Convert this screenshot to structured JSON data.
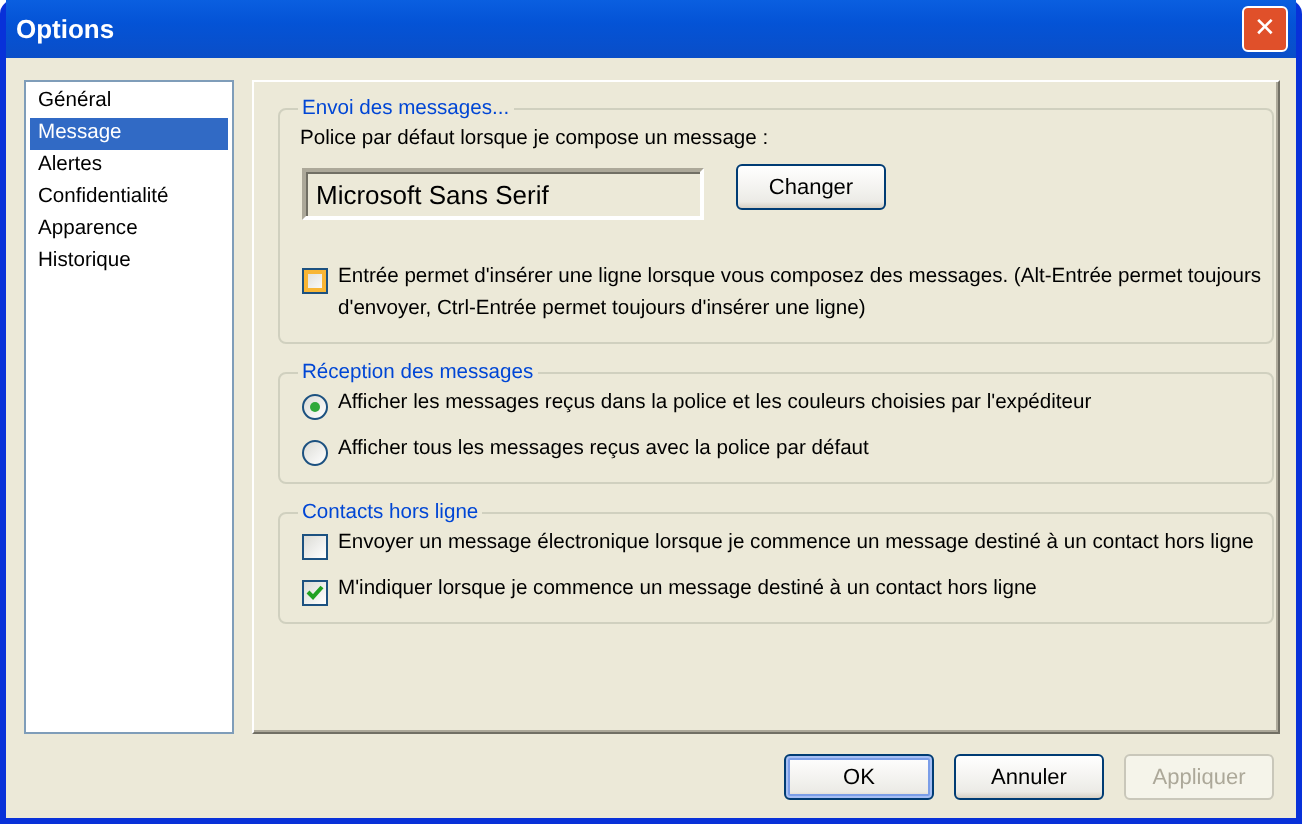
{
  "window": {
    "title": "Options",
    "close_glyph": "✕"
  },
  "sidebar": {
    "items": [
      {
        "label": "Général",
        "selected": false
      },
      {
        "label": "Message",
        "selected": true
      },
      {
        "label": "Alertes",
        "selected": false
      },
      {
        "label": "Confidentialité",
        "selected": false
      },
      {
        "label": "Apparence",
        "selected": false
      },
      {
        "label": "Historique",
        "selected": false
      }
    ]
  },
  "groups": [
    {
      "title": "Envoi des messages...",
      "items": [
        {
          "kind": "label",
          "text": "Police par défaut lorsque je compose un message :"
        },
        {
          "kind": "font",
          "value": "Microsoft Sans Serif",
          "button": "Changer"
        },
        {
          "kind": "checkbox",
          "text": "Entrée permet d'insérer une ligne lorsque vous composez des messages. (Alt-Entrée permet toujours d'envoyer, Ctrl-Entrée permet toujours d'insérer une ligne)",
          "checked": false,
          "hovered": true
        }
      ]
    },
    {
      "title": "Réception des messages",
      "items": [
        {
          "kind": "radio",
          "text": "Afficher les messages reçus dans la police et les couleurs choisies par l'expéditeur",
          "selected": true
        },
        {
          "kind": "radio",
          "text": "Afficher tous les messages reçus avec la police par défaut",
          "selected": false
        }
      ]
    },
    {
      "title": "Contacts hors ligne",
      "items": [
        {
          "kind": "checkbox",
          "text": "Envoyer un message électronique lorsque je commence un message destiné à un contact hors ligne",
          "checked": false,
          "hovered": false
        },
        {
          "kind": "checkbox",
          "text": "M'indiquer lorsque je commence un message destiné à un contact hors ligne",
          "checked": true,
          "hovered": false
        }
      ]
    }
  ],
  "buttons": [
    {
      "label": "OK",
      "default": true,
      "disabled": false
    },
    {
      "label": "Annuler",
      "default": false,
      "disabled": false
    },
    {
      "label": "Appliquer",
      "default": false,
      "disabled": true
    }
  ]
}
